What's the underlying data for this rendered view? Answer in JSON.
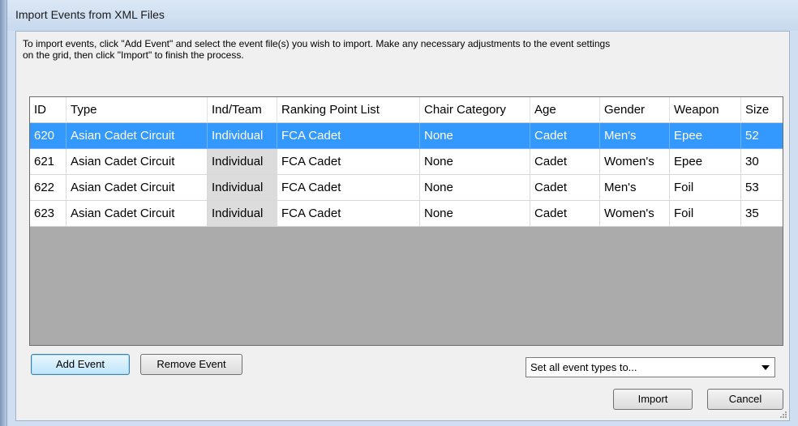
{
  "window": {
    "title": "Import Events from XML Files"
  },
  "instructions": "To import events, click \"Add Event\" and select the event file(s) you wish to import.  Make any necessary adjustments to the event settings\non the grid, then click \"Import\" to finish the process.",
  "grid": {
    "columns": [
      "ID",
      "Type",
      "Ind/Team",
      "Ranking Point List",
      "Chair Category",
      "Age",
      "Gender",
      "Weapon",
      "Size"
    ],
    "rows": [
      {
        "selected": true,
        "cells": [
          "620",
          "Asian Cadet Circuit",
          "Individual",
          "FCA Cadet",
          "None",
          "Cadet",
          "Men's",
          "Epee",
          "52"
        ]
      },
      {
        "selected": false,
        "cells": [
          "621",
          "Asian Cadet Circuit",
          "Individual",
          "FCA Cadet",
          "None",
          "Cadet",
          "Women's",
          "Epee",
          "30"
        ]
      },
      {
        "selected": false,
        "cells": [
          "622",
          "Asian Cadet Circuit",
          "Individual",
          "FCA Cadet",
          "None",
          "Cadet",
          "Men's",
          "Foil",
          "53"
        ]
      },
      {
        "selected": false,
        "cells": [
          "623",
          "Asian Cadet Circuit",
          "Individual",
          "FCA Cadet",
          "None",
          "Cadet",
          "Women's",
          "Foil",
          "35"
        ]
      }
    ]
  },
  "buttons": {
    "add_event": "Add Event",
    "remove_event": "Remove Event",
    "import": "Import",
    "cancel": "Cancel"
  },
  "event_type_select": {
    "selected": "Set all event types to..."
  }
}
